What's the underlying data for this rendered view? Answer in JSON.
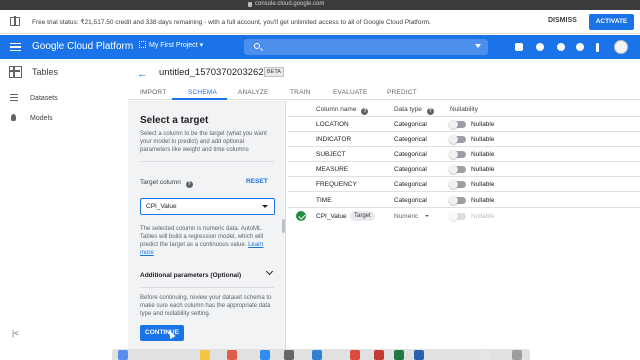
{
  "browser": {
    "url": "console.cloud.google.com"
  },
  "banner": {
    "text": "Free trial status: ₹21,517.50 credit and 338 days remaining - with a full account, you'll get unlimited access to all of Google Cloud Platform.",
    "dismiss": "DISMISS",
    "activate": "ACTIVATE"
  },
  "header": {
    "title": "Google Cloud Platform",
    "project": "My First Project"
  },
  "sidebar": {
    "title": "Tables",
    "items": [
      {
        "label": "Datasets",
        "icon": "list-icon"
      },
      {
        "label": "Models",
        "icon": "lightbulb-icon"
      }
    ]
  },
  "dataset": {
    "title": "untitled_1570370203262",
    "badge": "BETA"
  },
  "tabs": [
    "IMPORT",
    "SCHEMA",
    "ANALYZE",
    "TRAIN",
    "EVALUATE",
    "PREDICT"
  ],
  "active_tab": "SCHEMA",
  "panel": {
    "heading": "Select a target",
    "description": "Select a column to be the target (what you want your model to predict) and add optional parameters like weight and time columns",
    "target_label": "Target column",
    "reset": "RESET",
    "target_value": "CPI_Value",
    "numeric_note": "The selected column is numeric data. AutoML Tables will build a regression model, which will predict the target as a continuous value.",
    "learn_more": "Learn more",
    "additional": "Additional parameters (Optional)",
    "before_note": "Before continuing, review your dataset schema to make sure each column has the appropriate data type and nullability setting.",
    "continue": "CONTINUE"
  },
  "table": {
    "headers": {
      "name": "Column name",
      "type": "Data type",
      "nullability": "Nullability"
    },
    "rows": [
      {
        "name": "LOCATION",
        "type": "Categorical",
        "nullable": "Nullable"
      },
      {
        "name": "INDICATOR",
        "type": "Categorical",
        "nullable": "Nullable"
      },
      {
        "name": "SUBJECT",
        "type": "Categorical",
        "nullable": "Nullable"
      },
      {
        "name": "MEASURE",
        "type": "Categorical",
        "nullable": "Nullable"
      },
      {
        "name": "FREQUENCY",
        "type": "Categorical",
        "nullable": "Nullable"
      },
      {
        "name": "TIME",
        "type": "Categorical",
        "nullable": "Nullable"
      },
      {
        "name": "CPI_Value",
        "chip": "Target",
        "type": "Numeric",
        "nullable": "Nullable"
      }
    ]
  },
  "colors": {
    "primary": "#1a73e8",
    "success": "#1e8e3e",
    "panel_bg": "#f1f3f4"
  }
}
